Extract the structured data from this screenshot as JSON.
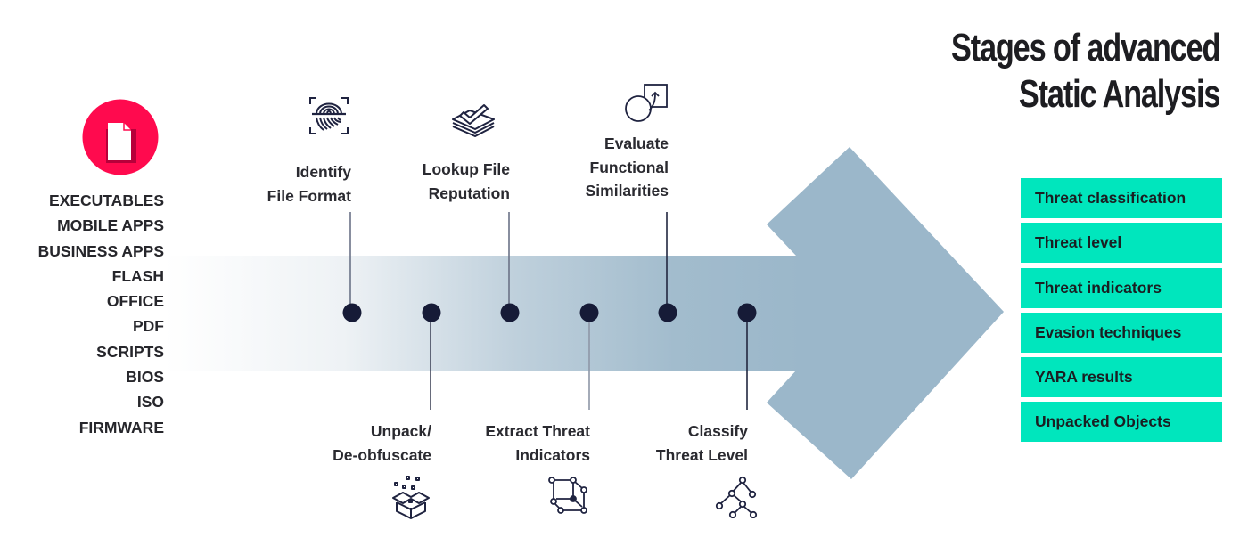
{
  "title": {
    "line1": "Stages of advanced",
    "line2": "Static Analysis"
  },
  "colors": {
    "accent_red": "#ff0a4e",
    "arrow": "#9bb7ca",
    "dot": "#161b37",
    "result_bg": "#00e6bd",
    "text": "#26262b"
  },
  "input": {
    "icon": "document-icon",
    "file_types": [
      "EXECUTABLES",
      "MOBILE APPS",
      "BUSINESS APPS",
      "FLASH",
      "OFFICE",
      "PDF",
      "SCRIPTS",
      "BIOS",
      "ISO",
      "FIRMWARE"
    ]
  },
  "stages": [
    {
      "order": 1,
      "position": "top",
      "icon": "fingerprint-icon",
      "line1": "Identify",
      "line2": "File Format"
    },
    {
      "order": 2,
      "position": "bottom",
      "icon": "open-box-icon",
      "line1": "Unpack/",
      "line2": "De-obfuscate"
    },
    {
      "order": 3,
      "position": "top",
      "icon": "layers-check-icon",
      "line1": "Lookup File",
      "line2": "Reputation"
    },
    {
      "order": 4,
      "position": "bottom",
      "icon": "node-cube-icon",
      "line1": "Extract Threat",
      "line2": "Indicators"
    },
    {
      "order": 5,
      "position": "top",
      "icon": "shapes-compare-icon",
      "line1": "Evaluate",
      "line2": "Functional",
      "line3": "Similarities"
    },
    {
      "order": 6,
      "position": "bottom",
      "icon": "tree-graph-icon",
      "line1": "Classify",
      "line2": "Threat Level"
    }
  ],
  "results": [
    "Threat classification",
    "Threat level",
    "Threat indicators",
    "Evasion techniques",
    "YARA results",
    "Unpacked Objects"
  ]
}
